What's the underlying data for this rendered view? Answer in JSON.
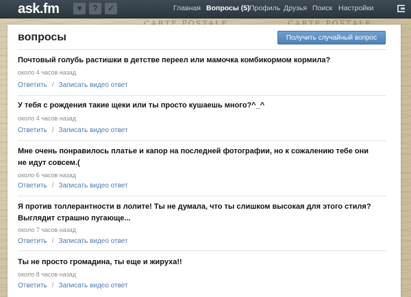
{
  "header": {
    "logo": "ask.fm",
    "nav": [
      "Главная",
      "Вопросы (5)",
      "Профиль",
      "Друзья",
      "Поиск",
      "Настройки"
    ],
    "active_nav": "Вопросы (5)"
  },
  "backdrop_text": [
    "CARTE POSTALE",
    "CARTE POSTALE"
  ],
  "page": {
    "title": "вопросы",
    "random_button": "Получить случайный вопрос"
  },
  "actions": {
    "answer": "Ответить",
    "separator": "/",
    "video": "Записать видео ответ"
  },
  "questions": [
    {
      "text": "Почтовый голубь растишки в детстве переел или мамочка комбикормом кормила?",
      "time": "около 4 часов назад"
    },
    {
      "text": "У тебя с рождения такие щеки или ты просто кушаешь много?^_^",
      "time": "около 4 часов назад"
    },
    {
      "text": "Мне очень понравилось платье и капор на последней фотографии, но к сожалению тебе они не идут совсем.(",
      "time": "около 6 часов назад"
    },
    {
      "text": "Я против толлерантности в лолите! Ты не думала, что ты слишком высокая для этого стиля? Выглядит страшно пугающе...",
      "time": "около 7 часов назад"
    },
    {
      "text": "Ты не просто громадина, ты еще и жируха!!",
      "time": "около 8 часов назад"
    }
  ]
}
